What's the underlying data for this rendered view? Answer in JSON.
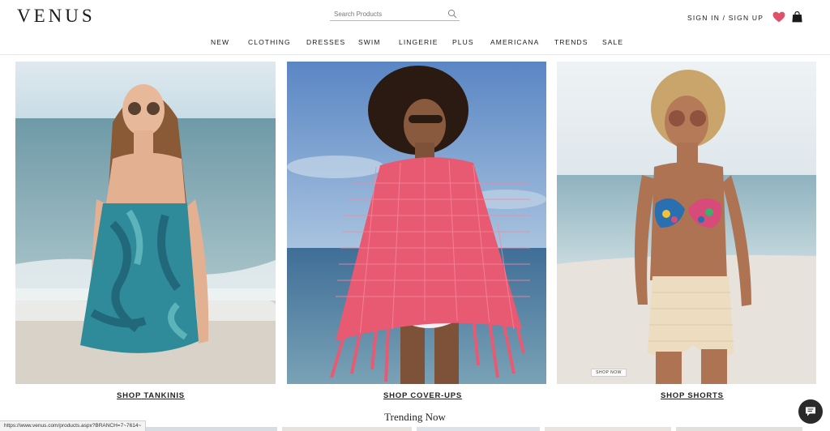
{
  "brand": {
    "logo": "VENUS"
  },
  "search": {
    "placeholder": "Search Products"
  },
  "account": {
    "sign_in_label": "SIGN IN / SIGN UP"
  },
  "icons": {
    "search": "search-icon",
    "wishlist": "heart-icon",
    "bag": "shopping-bag-icon",
    "chat": "chat-icon"
  },
  "colors": {
    "accent": "#e0506a",
    "text": "#1a1a1a"
  },
  "nav": {
    "items": [
      {
        "label": "NEW"
      },
      {
        "label": "CLOTHING"
      },
      {
        "label": "DRESSES"
      },
      {
        "label": "SWIM"
      },
      {
        "label": "LINGERIE"
      },
      {
        "label": "PLUS"
      },
      {
        "label": "AMERICANA"
      },
      {
        "label": "TRENDS"
      },
      {
        "label": "SALE"
      }
    ]
  },
  "tiles": [
    {
      "link": "SHOP TANKINIS"
    },
    {
      "link": "SHOP COVER-UPS"
    },
    {
      "link": "SHOP SHORTS",
      "badge": "SHOP NOW"
    }
  ],
  "section": {
    "trending_title": "Trending Now"
  },
  "status_bar": {
    "url": "https://www.venus.com/products.aspx?BRANCH=7~7614~"
  }
}
